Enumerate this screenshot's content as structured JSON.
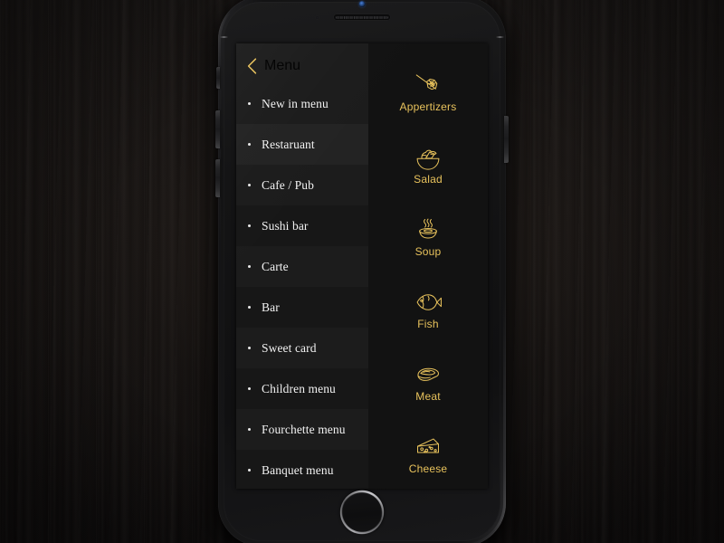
{
  "background": {
    "surface": "dark wood table",
    "color": "#141111"
  },
  "device": {
    "name": "smartphone-mockup",
    "body_color": "#191919",
    "hardware": {
      "front_camera": "camera-icon",
      "earpiece_speaker": "speaker-grille-icon",
      "proximity_sensor": "sensor-icon",
      "home_button": "home-button",
      "silent_switch": "silent-switch-button",
      "volume_up": "volume-up-button",
      "volume_down": "volume-down-button",
      "power": "power-button"
    }
  },
  "app": {
    "theme": {
      "accent": "#e8c25c",
      "screen_background": "#121212",
      "list_background": "#1c1c1c",
      "list_background_alt": "#171717",
      "highlight_background": "#232323",
      "text": "#f2f2f2"
    },
    "header": {
      "back_icon": "chevron-left-icon",
      "title": "Menu"
    },
    "menu_list": [
      {
        "label": "New in menu",
        "bullet": "•",
        "state": "default"
      },
      {
        "label": "Restaruant",
        "bullet": "•",
        "state": "highlighted"
      },
      {
        "label": "Cafe / Pub",
        "bullet": "•",
        "state": "default"
      },
      {
        "label": "Sushi bar",
        "bullet": "•",
        "state": "default"
      },
      {
        "label": "Carte",
        "bullet": "•",
        "state": "default"
      },
      {
        "label": "Bar",
        "bullet": "•",
        "state": "default"
      },
      {
        "label": "Sweet card",
        "bullet": "•",
        "state": "default"
      },
      {
        "label": "Children menu",
        "bullet": "•",
        "state": "default"
      },
      {
        "label": "Fourchette menu",
        "bullet": "•",
        "state": "default"
      },
      {
        "label": "Banquet menu",
        "bullet": "•",
        "state": "default"
      }
    ],
    "categories": [
      {
        "label": "Appertizers",
        "icon": "canape-skewer-icon"
      },
      {
        "label": "Salad",
        "icon": "salad-bowl-icon"
      },
      {
        "label": "Soup",
        "icon": "soup-bowl-icon"
      },
      {
        "label": "Fish",
        "icon": "fish-icon"
      },
      {
        "label": "Meat",
        "icon": "steak-icon"
      },
      {
        "label": "Cheese",
        "icon": "cheese-wedge-icon"
      }
    ],
    "categories_overflow": {
      "label": "",
      "icon": "partial-cut-off-icon",
      "note": "next category icon clipped by screen bottom"
    }
  }
}
